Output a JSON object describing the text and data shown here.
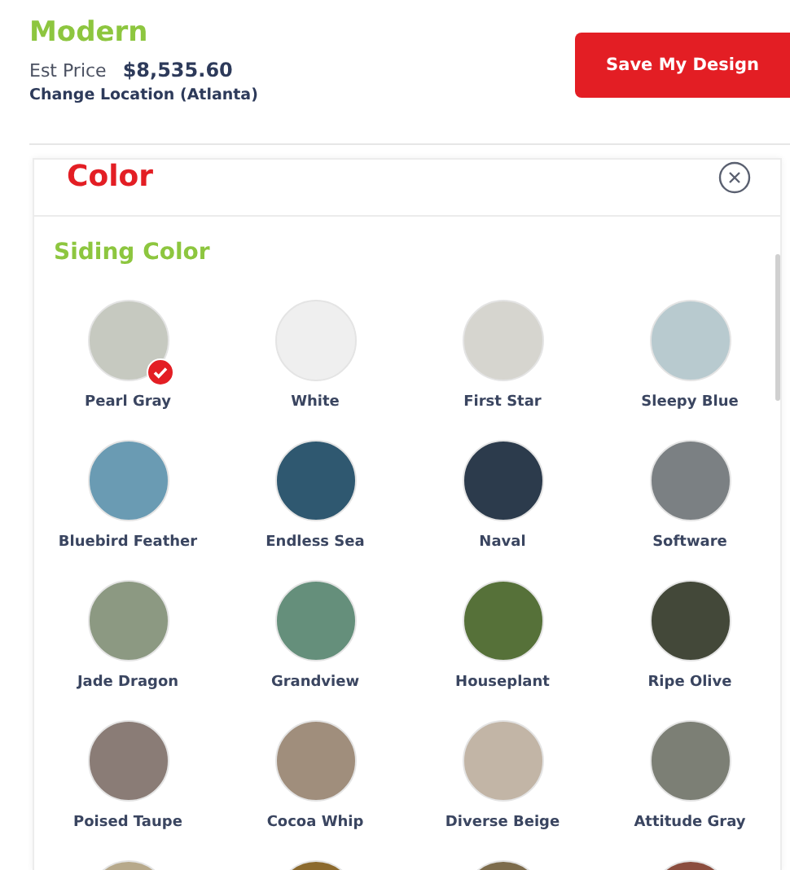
{
  "header": {
    "title": "Modern",
    "price_label": "Est Price",
    "price": "$8,535.60",
    "location_link": "Change Location (Atlanta)",
    "save_button": "Save My Design"
  },
  "panel": {
    "title": "Color",
    "section_title": "Siding Color",
    "swatches": [
      {
        "name": "Pearl Gray",
        "color": "#c6c9c0",
        "selected": true
      },
      {
        "name": "White",
        "color": "#efefef",
        "selected": false
      },
      {
        "name": "First Star",
        "color": "#d6d5cf",
        "selected": false
      },
      {
        "name": "Sleepy Blue",
        "color": "#b8cacf",
        "selected": false
      },
      {
        "name": "Bluebird Feather",
        "color": "#6a9bb3",
        "selected": false
      },
      {
        "name": "Endless Sea",
        "color": "#2f5870",
        "selected": false
      },
      {
        "name": "Naval",
        "color": "#2c3b4c",
        "selected": false
      },
      {
        "name": "Software",
        "color": "#7b8083",
        "selected": false
      },
      {
        "name": "Jade Dragon",
        "color": "#8c9982",
        "selected": false
      },
      {
        "name": "Grandview",
        "color": "#658f7b",
        "selected": false
      },
      {
        "name": "Houseplant",
        "color": "#567139",
        "selected": false
      },
      {
        "name": "Ripe Olive",
        "color": "#434839",
        "selected": false
      },
      {
        "name": "Poised Taupe",
        "color": "#8a7c76",
        "selected": false
      },
      {
        "name": "Cocoa Whip",
        "color": "#a08e7c",
        "selected": false
      },
      {
        "name": "Diverse Beige",
        "color": "#c2b5a6",
        "selected": false
      },
      {
        "name": "Attitude Gray",
        "color": "#7c7f75",
        "selected": false
      },
      {
        "color": "#b7a98b"
      },
      {
        "color": "#8c6a2e"
      },
      {
        "color": "#7d6c4c"
      },
      {
        "color": "#8b4d3e"
      }
    ]
  }
}
